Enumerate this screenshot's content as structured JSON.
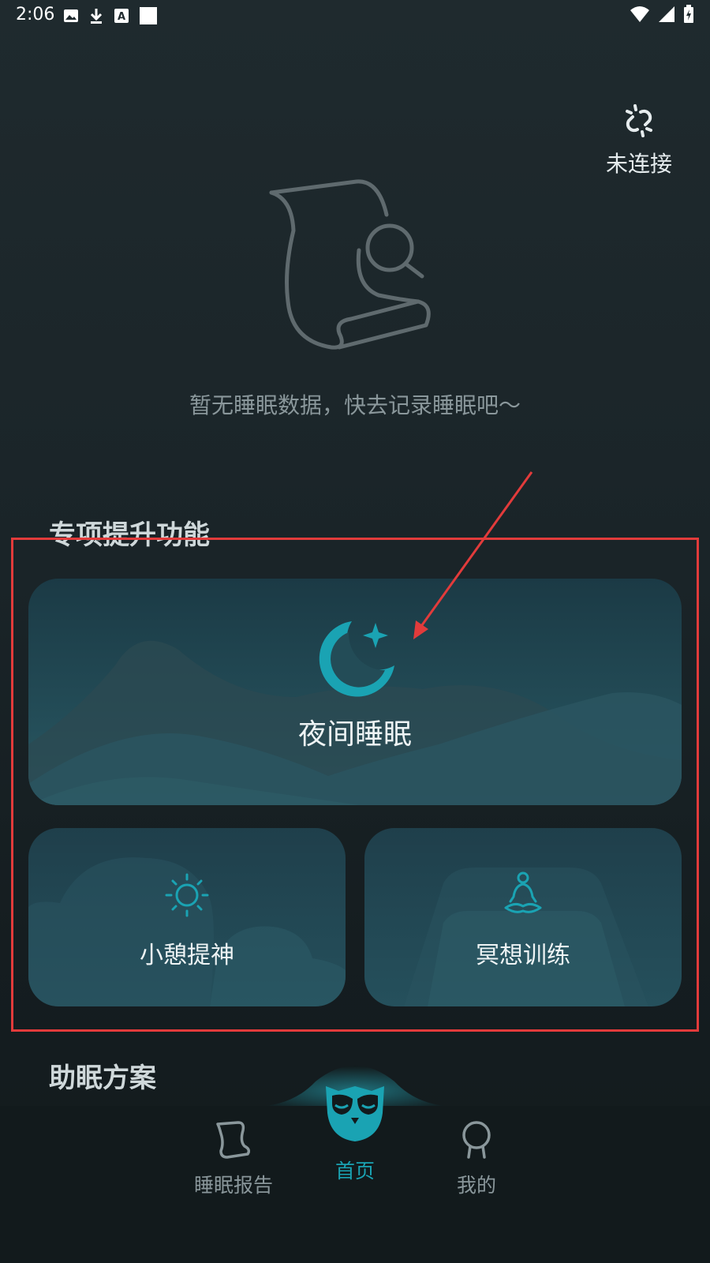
{
  "status_bar": {
    "time": "2:06",
    "icons": [
      "image-icon",
      "download-icon",
      "font-icon",
      "square-icon"
    ],
    "right_icons": [
      "wifi-icon",
      "signal-icon",
      "battery-charging-icon"
    ]
  },
  "device": {
    "status_label": "未连接",
    "icon": "unlink-icon"
  },
  "empty_state": {
    "icon": "scroll-search-icon",
    "message": "暂无睡眠数据，快去记录睡眠吧～"
  },
  "sections": {
    "special": "专项提升功能",
    "sleep_aid": "助眠方案"
  },
  "cards": {
    "night_sleep": {
      "label": "夜间睡眠",
      "icon": "moon-star-icon"
    },
    "nap": {
      "label": "小憩提神",
      "icon": "sun-icon"
    },
    "meditation": {
      "label": "冥想训练",
      "icon": "meditation-icon"
    }
  },
  "nav": {
    "items": [
      {
        "label": "睡眠报告",
        "icon": "report-scroll-icon",
        "active": false
      },
      {
        "label": "首页",
        "icon": "owl-icon",
        "active": true
      },
      {
        "label": "我的",
        "icon": "profile-icon",
        "active": false
      }
    ]
  },
  "colors": {
    "accent": "#1aa3b3",
    "annotation": "#e23b3b",
    "inactive": "#8a979b"
  }
}
